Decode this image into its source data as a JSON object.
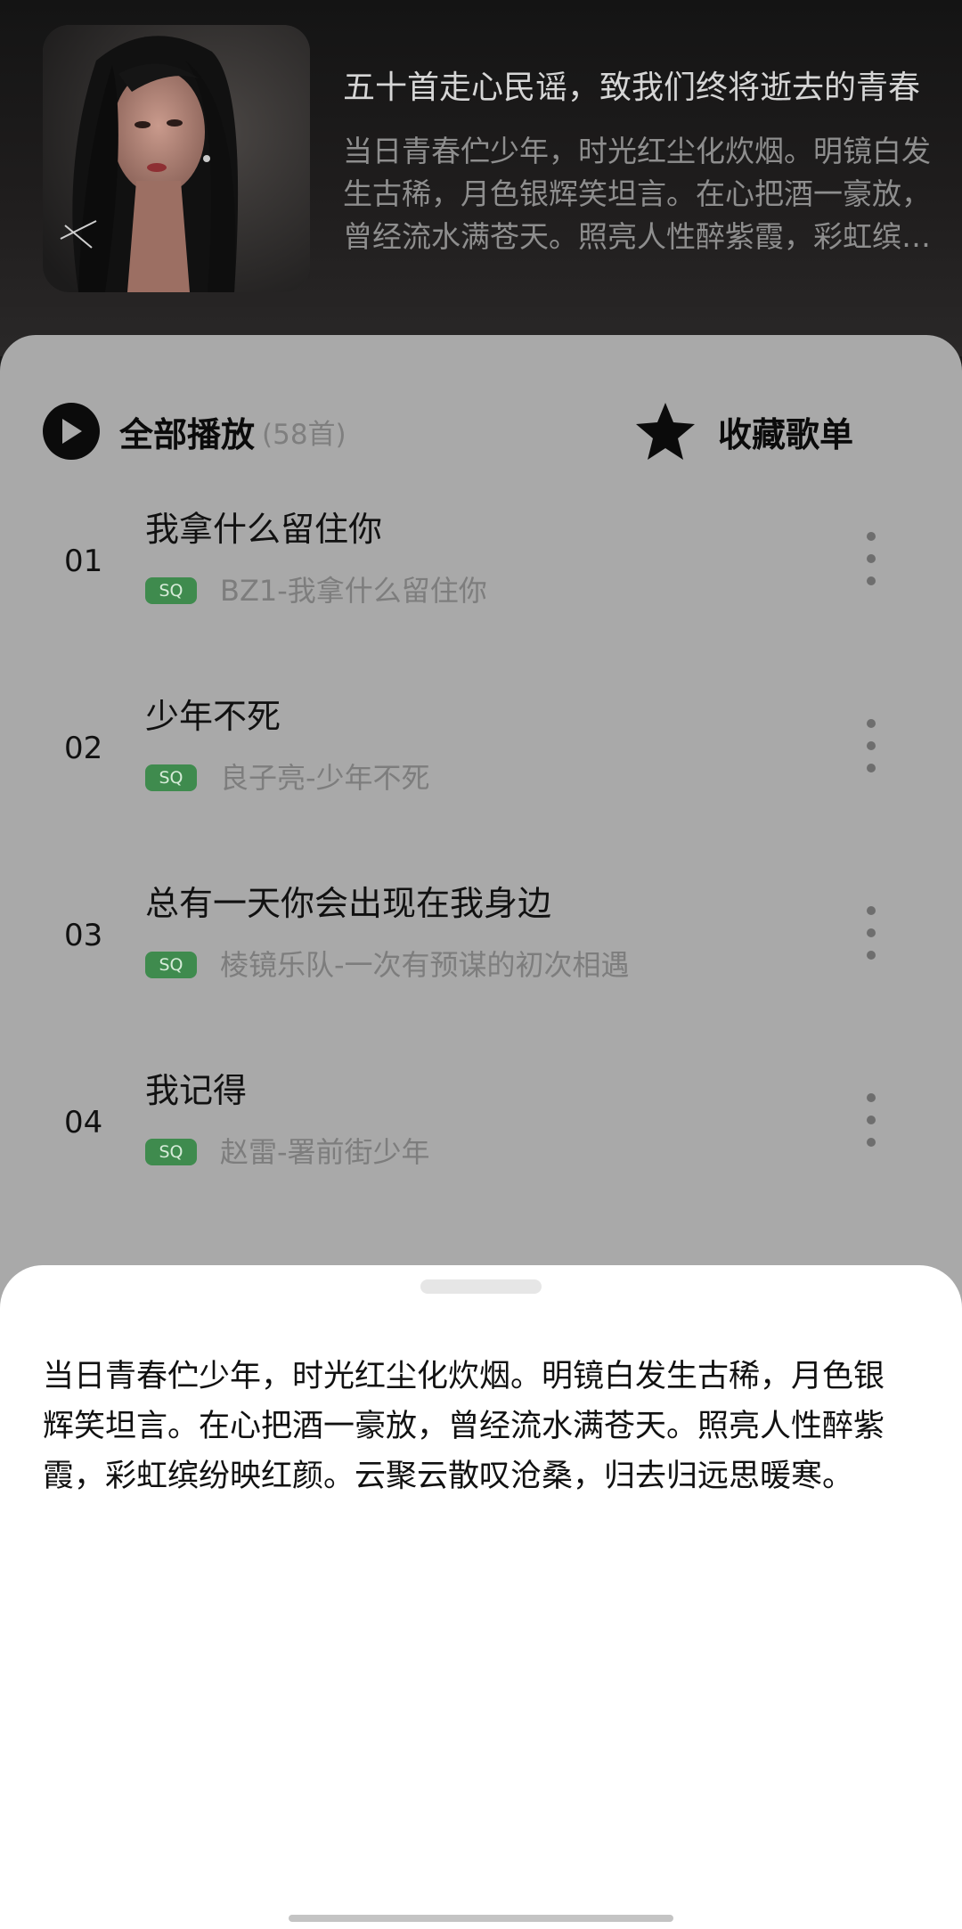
{
  "playlist": {
    "title": "五十首走心民谣，致我们终将逝去的青春",
    "description_preview": "当日青春伫少年，时光红尘化炊烟。明镜白发生古稀，月色银辉笑坦言。在心把酒一豪放，曾经流水满苍天。照亮人性醉紫霞，彩虹缤纷映红颜。云聚云散叹沧桑，归去归远思暖寒。",
    "cover": "portrait-photo"
  },
  "actions": {
    "play_all_label": "全部播放",
    "play_all_count": "(58首)",
    "favorite_label": "收藏歌单",
    "play_icon": "play-circle-icon",
    "favorite_icon": "star-icon"
  },
  "songs": [
    {
      "index": "01",
      "title": "我拿什么留住你",
      "badge": "SQ",
      "subtitle": "BZ1-我拿什么留住你"
    },
    {
      "index": "02",
      "title": "少年不死",
      "badge": "SQ",
      "subtitle": "良子亮-少年不死"
    },
    {
      "index": "03",
      "title": "总有一天你会出现在我身边",
      "badge": "SQ",
      "subtitle": "棱镜乐队-一次有预谋的初次相遇"
    },
    {
      "index": "04",
      "title": "我记得",
      "badge": "SQ",
      "subtitle": "赵雷-署前街少年"
    }
  ],
  "sheet": {
    "text": "当日青春伫少年，时光红尘化炊烟。明镜白发生古稀，月色银辉笑坦言。在心把酒一豪放，曾经流水满苍天。照亮人性醉紫霞，彩虹缤纷映红颜。云聚云散叹沧桑，归去归远思暖寒。"
  },
  "colors": {
    "badge_green": "#3f8b4e",
    "dim_overlay": "#a9a9a9",
    "header_dark": "#1a1a1a"
  }
}
